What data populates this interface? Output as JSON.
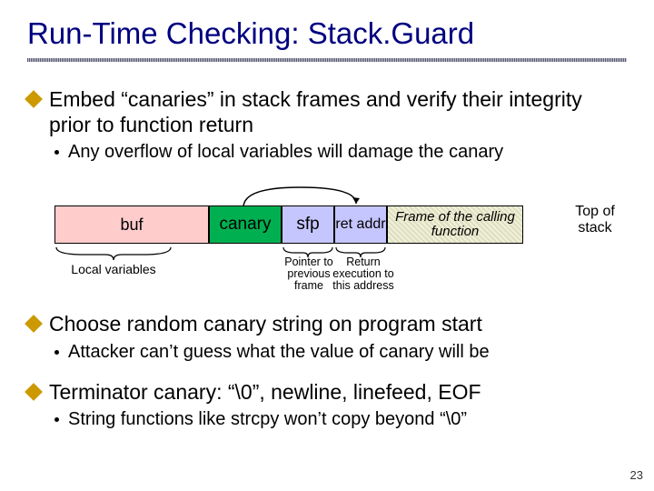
{
  "title": "Run-Time Checking: Stack.Guard",
  "bullets": {
    "b1a": "Embed “canaries” in stack frames and verify their integrity prior to function return",
    "b1a_s1": "Any overflow of local variables will damage the canary",
    "b2a": "Choose random canary string on program start",
    "b2a_s1": "Attacker can’t guess what the value of canary will be",
    "b3a": "Terminator canary: “\\0”, newline, linefeed, EOF",
    "b3a_s1": "String functions like strcpy won’t copy beyond “\\0”"
  },
  "diagram": {
    "buf": "buf",
    "canary": "canary",
    "sfp": "sfp",
    "ret": "ret addr",
    "frame": "Frame of the calling function",
    "tos": "Top of stack",
    "local_vars": "Local variables",
    "sfp_note": "Pointer to previous frame",
    "ret_note": "Return execution to this address"
  },
  "slidenum": "23"
}
